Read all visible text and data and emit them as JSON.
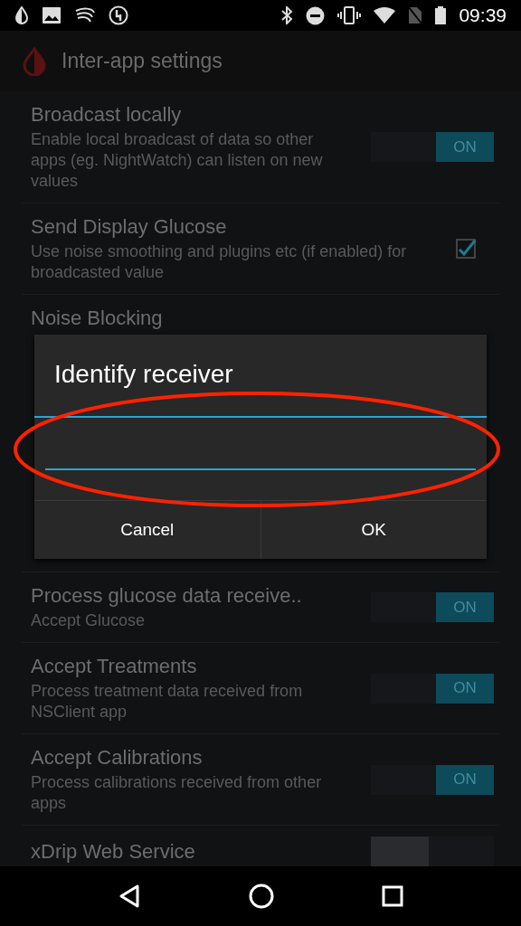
{
  "status_bar": {
    "time": "09:39"
  },
  "action_bar": {
    "title": "Inter-app settings"
  },
  "settings": [
    {
      "kind": "toggle",
      "title": "Broadcast locally",
      "summary": "Enable local broadcast of data so other apps (eg. NightWatch) can listen on new values",
      "on": true,
      "label": "ON"
    },
    {
      "kind": "checkbox",
      "title": "Send Display Glucose",
      "summary": "Use noise smoothing and plugins etc (if enabled) for broadcasted value",
      "checked": true
    },
    {
      "kind": "covered",
      "title": "Noise Blocking"
    },
    {
      "kind": "toggle",
      "title": "Process glucose data receive..",
      "summary": "Accept Glucose",
      "on": true,
      "label": "ON"
    },
    {
      "kind": "toggle",
      "title": "Accept Treatments",
      "summary": "Process treatment data received from NSClient app",
      "on": true,
      "label": "ON"
    },
    {
      "kind": "toggle",
      "title": "Accept Calibrations",
      "summary": "Process calibrations received from other apps",
      "on": true,
      "label": "ON"
    },
    {
      "kind": "toggle",
      "title": "xDrip Web Service",
      "on": false
    }
  ],
  "dialog": {
    "title": "Identify receiver",
    "buttons": [
      "Cancel",
      "OK"
    ]
  }
}
